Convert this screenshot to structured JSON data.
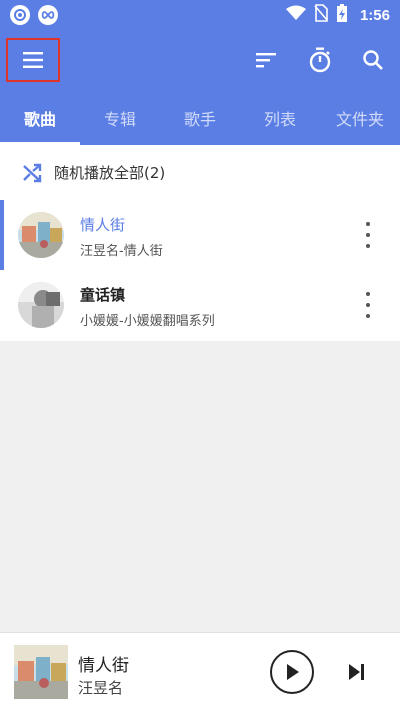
{
  "status_bar": {
    "time": "1:56",
    "icons": [
      "notification-circle-icon",
      "infinity-circle-icon",
      "wifi-icon",
      "no-sim-icon",
      "battery-charging-icon"
    ]
  },
  "app_bar": {
    "icons": [
      "menu-icon",
      "sort-icon",
      "timer-icon",
      "search-icon"
    ],
    "colors": {
      "primary": "#5b7ee5",
      "highlight_border": "#e0342a"
    }
  },
  "tabs": [
    {
      "label": "歌曲",
      "active": true
    },
    {
      "label": "专辑",
      "active": false
    },
    {
      "label": "歌手",
      "active": false
    },
    {
      "label": "列表",
      "active": false
    },
    {
      "label": "文件夹",
      "active": false
    }
  ],
  "shuffle": {
    "label": "随机播放全部(2)",
    "icon": "shuffle-icon"
  },
  "songs": [
    {
      "title": "情人街",
      "subtitle": "汪昱名-情人街",
      "active": true
    },
    {
      "title": "童话镇",
      "subtitle": "小媛媛-小媛媛翻唱系列",
      "active": false
    }
  ],
  "player": {
    "title": "情人街",
    "artist": "汪昱名",
    "icons": [
      "play-icon",
      "skip-next-icon"
    ]
  }
}
